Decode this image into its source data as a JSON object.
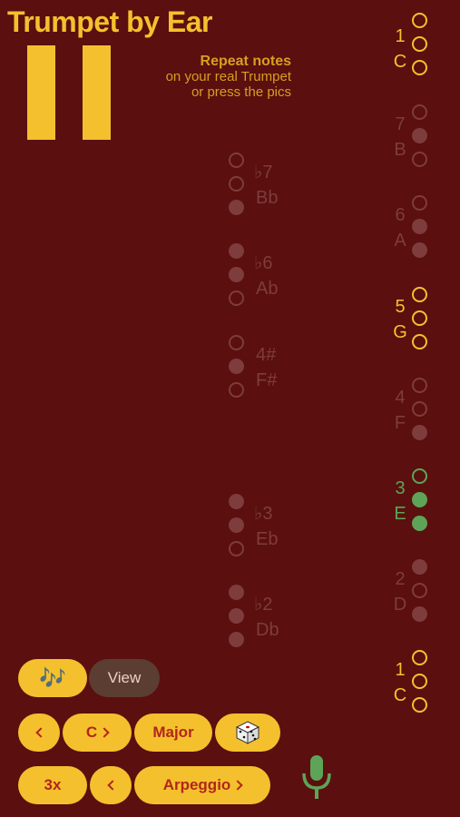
{
  "header": {
    "title": "Trumpet by Ear",
    "instruction_bold": "Repeat notes",
    "instruction_line1": "on your real Trumpet",
    "instruction_line2": "or press the pics"
  },
  "colors": {
    "background": "#5b0f0f",
    "accent": "#f5c02d",
    "dim": "#7e3c3c",
    "green": "#5ea458",
    "button_text": "#b1261c"
  },
  "right_notes": [
    {
      "degree": "1",
      "name": "C",
      "valves": [
        "open",
        "open",
        "open"
      ],
      "state": "active"
    },
    {
      "degree": "7",
      "name": "B",
      "valves": [
        "open",
        "pressed",
        "open"
      ],
      "state": "dim"
    },
    {
      "degree": "6",
      "name": "A",
      "valves": [
        "open",
        "pressed",
        "pressed"
      ],
      "state": "dim"
    },
    {
      "degree": "5",
      "name": "G",
      "valves": [
        "open",
        "open",
        "open"
      ],
      "state": "active"
    },
    {
      "degree": "4",
      "name": "F",
      "valves": [
        "open",
        "open",
        "pressed"
      ],
      "state": "dim"
    },
    {
      "degree": "3",
      "name": "E",
      "valves": [
        "open",
        "pressed",
        "pressed"
      ],
      "state": "green"
    },
    {
      "degree": "2",
      "name": "D",
      "valves": [
        "pressed",
        "open",
        "pressed"
      ],
      "state": "dim"
    },
    {
      "degree": "1",
      "name": "C",
      "valves": [
        "open",
        "open",
        "open"
      ],
      "state": "active"
    }
  ],
  "left_notes": [
    {
      "degree": "♭7",
      "name": "Bb",
      "valves": [
        "open",
        "open",
        "pressed"
      ]
    },
    {
      "degree": "♭6",
      "name": "Ab",
      "valves": [
        "pressed",
        "pressed",
        "open"
      ]
    },
    {
      "degree": "4#",
      "name": "F#",
      "valves": [
        "open",
        "pressed",
        "open"
      ]
    },
    {
      "degree": "♭3",
      "name": "Eb",
      "valves": [
        "pressed",
        "pressed",
        "open"
      ]
    },
    {
      "degree": "♭2",
      "name": "Db",
      "valves": [
        "pressed",
        "pressed",
        "pressed"
      ]
    }
  ],
  "controls": {
    "notes_icon": "🎶",
    "view_label": "View",
    "key_label": "C",
    "scale_label": "Major",
    "dice_icon": "dice-icon",
    "repeat_label": "3x",
    "mode_label": "Arpeggio",
    "mic_icon": "microphone-icon"
  }
}
